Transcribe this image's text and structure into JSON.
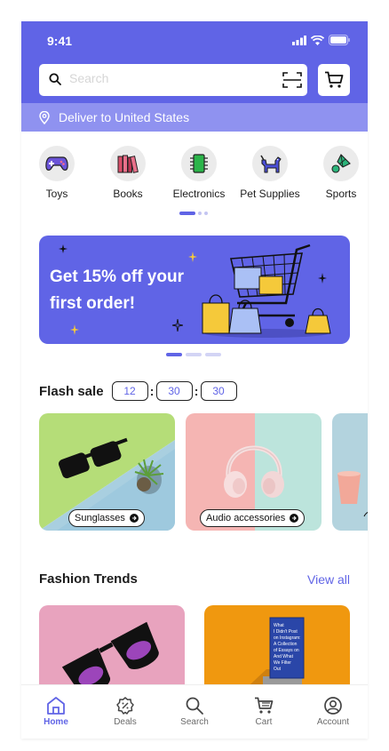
{
  "status_bar": {
    "time": "9:41"
  },
  "search": {
    "placeholder": "Search"
  },
  "deliver": {
    "label": "Deliver to United States"
  },
  "categories": [
    {
      "label": "Toys",
      "icon": "game-controller-icon"
    },
    {
      "label": "Books",
      "icon": "books-icon"
    },
    {
      "label": "Electronics",
      "icon": "chip-icon"
    },
    {
      "label": "Pet Supplies",
      "icon": "dog-icon"
    },
    {
      "label": "Sports",
      "icon": "shuttlecock-icon"
    }
  ],
  "banner": {
    "title": "Get 15% off your first order!"
  },
  "flash_sale": {
    "title": "Flash sale",
    "timer": {
      "hours": "12",
      "minutes": "30",
      "seconds": "30"
    },
    "items": [
      {
        "label": "Sunglasses"
      },
      {
        "label": "Audio accessories"
      }
    ]
  },
  "fashion_trends": {
    "title": "Fashion Trends",
    "view_all": "View all"
  },
  "tabbar": [
    {
      "label": "Home",
      "icon": "home-icon",
      "active": true
    },
    {
      "label": "Deals",
      "icon": "deals-badge-icon",
      "active": false
    },
    {
      "label": "Search",
      "icon": "search-icon",
      "active": false
    },
    {
      "label": "Cart",
      "icon": "cart-icon",
      "active": false
    },
    {
      "label": "Account",
      "icon": "account-icon",
      "active": false
    }
  ],
  "colors": {
    "primary": "#6064e6",
    "deliver_bar": "#8f92f0",
    "category_bg": "#ebebeb"
  }
}
